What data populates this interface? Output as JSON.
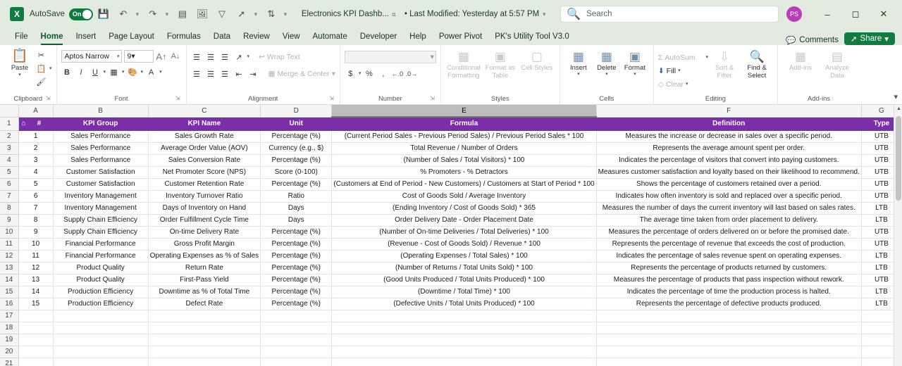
{
  "titlebar": {
    "logo": "X",
    "autosave_label": "AutoSave",
    "autosave_state": "On",
    "quick_icons": [
      "save-icon",
      "undo-icon",
      "redo-icon",
      "table-icon",
      "picture-icon",
      "filter-icon",
      "share-arrow-icon",
      "sort-icon",
      "customize-qat-icon"
    ],
    "doc_title": "Electronics KPI Dashb...",
    "doc_meta": "• Last Modified: Yesterday at 5:57 PM",
    "search_placeholder": "Search",
    "avatar_initials": "PS",
    "window_buttons": [
      "minimize",
      "restore",
      "close"
    ]
  },
  "ribbon_tabs": {
    "items": [
      "File",
      "Home",
      "Insert",
      "Page Layout",
      "Formulas",
      "Data",
      "Review",
      "View",
      "Automate",
      "Developer",
      "Help",
      "Power Pivot",
      "PK's Utility Tool V3.0"
    ],
    "active": "Home",
    "comments_label": "Comments",
    "share_label": "Share"
  },
  "ribbon": {
    "clipboard": {
      "label": "Clipboard",
      "paste_label": "Paste",
      "cut_label": "Cut",
      "copy_label": "Copy",
      "format_painter_label": "Format Painter"
    },
    "font": {
      "label": "Font",
      "font_name": "Aptos Narrow",
      "font_size": "9",
      "grow_label": "A",
      "shrink_label": "A",
      "bold": "B",
      "italic": "I",
      "underline": "U",
      "borders": "borders-icon",
      "fill_color": "fill-color-icon",
      "font_color": "font-color-icon"
    },
    "alignment": {
      "label": "Alignment",
      "wrap_text": "Wrap Text",
      "merge_center": "Merge & Center"
    },
    "number": {
      "label": "Number",
      "format_value": "",
      "currency": "$",
      "percent": "%",
      "comma": ","
    },
    "styles": {
      "label": "Styles",
      "conditional_formatting": "Conditional Formatting",
      "format_as_table": "Format as Table",
      "cell_styles": "Cell Styles"
    },
    "cells": {
      "label": "Cells",
      "insert": "Insert",
      "delete": "Delete",
      "format": "Format"
    },
    "editing": {
      "label": "Editing",
      "autosum": "AutoSum",
      "fill": "Fill",
      "clear": "Clear",
      "sort_filter": "Sort & Filter",
      "find_select": "Find & Select"
    },
    "addins": {
      "label": "Add-ins",
      "addins_btn": "Add-ins",
      "analyze_data": "Analyze Data"
    }
  },
  "sheet": {
    "column_letters": [
      "A",
      "B",
      "C",
      "D",
      "E",
      "F",
      "G"
    ],
    "selected_column": "E",
    "row_numbers": [
      "1",
      "2",
      "3",
      "4",
      "5",
      "6",
      "7",
      "8",
      "9",
      "10",
      "11",
      "12",
      "13",
      "14",
      "15",
      "16",
      "17",
      "18",
      "19",
      "20",
      "21"
    ],
    "headers": [
      "#",
      "KPI Group",
      "KPI Name",
      "Unit",
      "Formula",
      "Definition",
      "Type"
    ],
    "rows": [
      [
        "1",
        "Sales Performance",
        "Sales Growth Rate",
        "Percentage (%)",
        "(Current Period Sales - Previous Period Sales) / Previous Period Sales * 100",
        "Measures the increase or decrease in sales over a specific period.",
        "UTB"
      ],
      [
        "2",
        "Sales Performance",
        "Average Order Value (AOV)",
        "Currency (e.g., $)",
        "Total Revenue / Number of Orders",
        "Represents the average amount spent per order.",
        "UTB"
      ],
      [
        "3",
        "Sales Performance",
        "Sales Conversion Rate",
        "Percentage (%)",
        "(Number of Sales / Total Visitors) * 100",
        "Indicates the percentage of visitors that convert into paying customers.",
        "UTB"
      ],
      [
        "4",
        "Customer Satisfaction",
        "Net Promoter Score (NPS)",
        "Score (0-100)",
        "% Promoters - % Detractors",
        "Measures customer satisfaction and loyalty based on their likelihood to recommend.",
        "UTB"
      ],
      [
        "5",
        "Customer Satisfaction",
        "Customer Retention Rate",
        "Percentage (%)",
        "(Customers at End of Period - New Customers) / Customers at Start of Period * 100",
        "Shows the percentage of customers retained over a period.",
        "UTB"
      ],
      [
        "6",
        "Inventory Management",
        "Inventory Turnover Ratio",
        "Ratio",
        "Cost of Goods Sold / Average Inventory",
        "Indicates how often inventory is sold and replaced over a specific period.",
        "UTB"
      ],
      [
        "7",
        "Inventory Management",
        "Days of Inventory on Hand",
        "Days",
        "(Ending Inventory / Cost of Goods Sold) * 365",
        "Measures the number of days the current inventory will last based on sales rates.",
        "LTB"
      ],
      [
        "8",
        "Supply Chain Efficiency",
        "Order Fulfillment Cycle Time",
        "Days",
        "Order Delivery Date - Order Placement Date",
        "The average time taken from order placement to delivery.",
        "LTB"
      ],
      [
        "9",
        "Supply Chain Efficiency",
        "On-time Delivery Rate",
        "Percentage (%)",
        "(Number of On-time Deliveries / Total Deliveries) * 100",
        "Measures the percentage of orders delivered on or before the promised date.",
        "UTB"
      ],
      [
        "10",
        "Financial Performance",
        "Gross Profit Margin",
        "Percentage (%)",
        "(Revenue - Cost of Goods Sold) / Revenue * 100",
        "Represents the percentage of revenue that exceeds the cost of production.",
        "UTB"
      ],
      [
        "11",
        "Financial Performance",
        "Operating Expenses as % of Sales",
        "Percentage (%)",
        "(Operating Expenses / Total Sales) * 100",
        "Indicates the percentage of sales revenue spent on operating expenses.",
        "LTB"
      ],
      [
        "12",
        "Product Quality",
        "Return Rate",
        "Percentage (%)",
        "(Number of Returns / Total Units Sold) * 100",
        "Represents the percentage of products returned by customers.",
        "LTB"
      ],
      [
        "13",
        "Product Quality",
        "First-Pass Yield",
        "Percentage (%)",
        "(Good Units Produced / Total Units Produced) * 100",
        "Measures the percentage of products that pass inspection without rework.",
        "UTB"
      ],
      [
        "14",
        "Production Efficiency",
        "Downtime as % of Total Time",
        "Percentage (%)",
        "(Downtime / Total Time) * 100",
        "Indicates the percentage of time the production process is halted.",
        "LTB"
      ],
      [
        "15",
        "Production Efficiency",
        "Defect Rate",
        "Percentage (%)",
        "(Defective Units / Total Units Produced) * 100",
        "Represents the percentage of defective products produced.",
        "LTB"
      ]
    ],
    "header_color": "#7a2ea8",
    "home_icon": "home-icon"
  }
}
